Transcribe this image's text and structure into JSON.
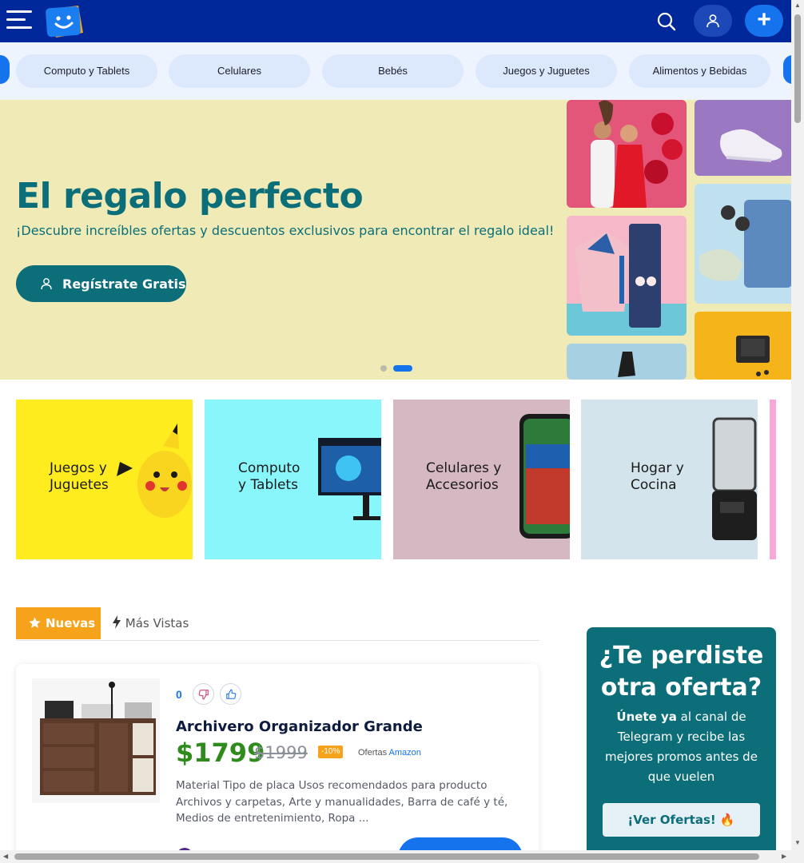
{
  "header": {
    "menu_icon": "hamburger-menu-icon",
    "logo_icon": "smiley-tag-logo",
    "search_icon": "search-icon",
    "user_icon": "user-icon",
    "add_label": "+"
  },
  "categories_nav": [
    "Computo y Tablets",
    "Celulares",
    "Bebés",
    "Juegos y Juguetes",
    "Alimentos y Bebidas"
  ],
  "hero": {
    "title": "El regalo perfecto",
    "subtitle": "¡Descubre increíbles ofertas y descuentos exclusivos para encontrar el regalo ideal!",
    "cta_label": "Regístrate Gratis",
    "slides_total": 2,
    "active_slide": 2
  },
  "category_cards": [
    {
      "line1": "Juegos y",
      "line2": "Juguetes",
      "bg": "#ffec1f"
    },
    {
      "line1": "Computo",
      "line2": "y Tablets",
      "bg": "#88f6fb"
    },
    {
      "line1": "Celulares y",
      "line2": "Accesorios",
      "bg": "#d6b8c3"
    },
    {
      "line1": "Hogar y",
      "line2": "Cocina",
      "bg": "#d3e4ec"
    }
  ],
  "tabs": {
    "active_label": "Nuevas",
    "other_label": "Más Vistas"
  },
  "product": {
    "votes": "0",
    "title": "Archivero Organizador Grande",
    "price": "$1799",
    "old_price": "$1999",
    "discount": "-10%",
    "store_prefix": "Ofertas",
    "store_name": "Amazon",
    "description": "Material Tipo de placa Usos recomendados para producto Archivos y carpetas, Arte y manualidades, Barra de café y té, Medios de entretenimiento, Ropa ..."
  },
  "promo": {
    "title_line1": "¿Te perdiste",
    "title_line2": "otra oferta?",
    "text_bold": "Únete ya",
    "text_rest": " al canal de Telegram y recibe las mejores promos antes de que vuelen",
    "button_label": "¡Ver Ofertas! 🔥"
  },
  "colors": {
    "navbar": "#00289a",
    "accent_blue": "#1673ee",
    "teal": "#0b6e79",
    "orange": "#f7a21b",
    "price_green": "#2e8b1c",
    "hero_bg": "#f0ebb6"
  }
}
